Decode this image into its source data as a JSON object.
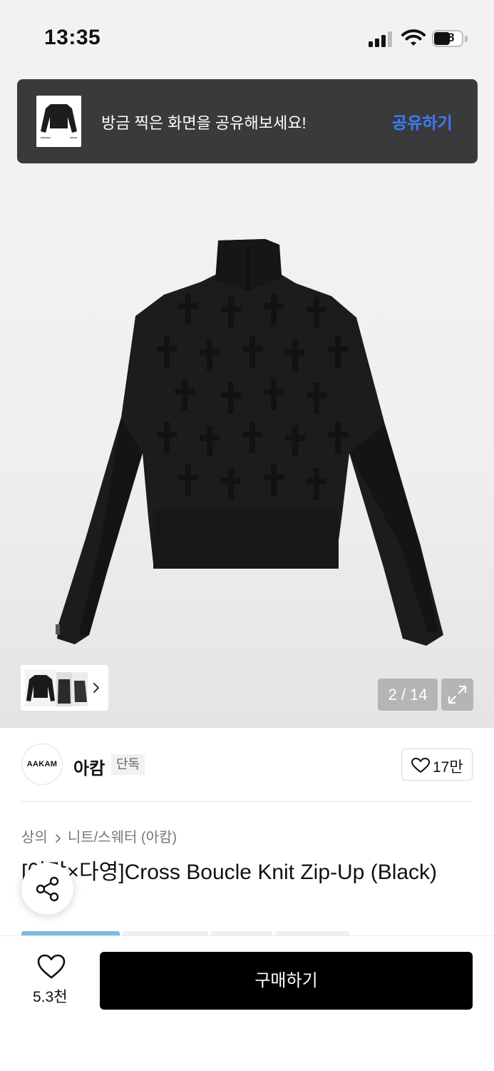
{
  "status_bar": {
    "time": "13:35",
    "battery": "48",
    "icons": [
      "signal-icon",
      "wifi-icon",
      "battery-icon"
    ]
  },
  "share_banner": {
    "message": "방금 찍은 화면을 공유해보세요!",
    "action": "공유하기"
  },
  "gallery": {
    "counter": "2 / 14",
    "icons": [
      "chevron-right-icon",
      "expand-icon"
    ]
  },
  "brand": {
    "logo_text": "AAKAM",
    "name": "아캄",
    "badge": "단독",
    "likes": "17만"
  },
  "breadcrumb": {
    "level1": "상의",
    "level2": "니트/스웨터 (아캄)"
  },
  "product": {
    "title": "[아캄×다영]Cross Boucle Knit Zip-Up (Black)"
  },
  "bottom_bar": {
    "wish_count": "5.3천",
    "buy_label": "구매하기"
  },
  "colors": {
    "banner_bg": "#3a3a3c",
    "share_blue": "#3d7bff",
    "buy_bg": "#000000",
    "tab_active": "#7dbbe6"
  }
}
